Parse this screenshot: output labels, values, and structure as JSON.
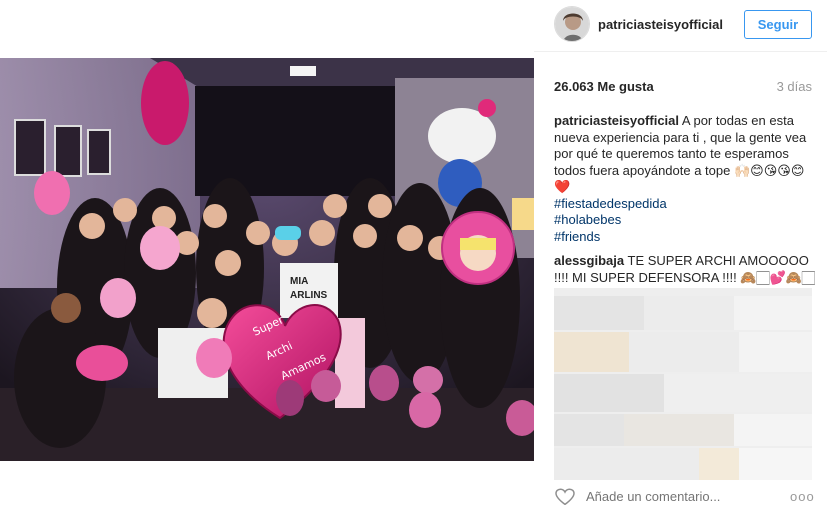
{
  "post": {
    "photo_alt": "Foto del post",
    "balloon_text_1": "Super",
    "balloon_text_2": "Archi",
    "balloon_text_3": "Amamos",
    "shirt_text_1": "MIA",
    "shirt_text_2": "ARLINS"
  },
  "header": {
    "username": "patriciasteisyofficial",
    "follow_label": "Seguir"
  },
  "stats": {
    "likes": "26.063 Me gusta",
    "time_ago": "3 días"
  },
  "caption": {
    "user": "patriciasteisyofficial",
    "text": "A por todas en esta nueva experiencia para ti , que la gente vea por qué te queremos tanto te esperamos todos fuera apoyándote a tope",
    "emoji_line": "🙌🏻😊😘😘😊❤️",
    "tags": [
      "#fiestadedespedida",
      "#holabebes",
      "#friends"
    ]
  },
  "comments": [
    {
      "user": "alessgibaja",
      "text": "TE SUPER ARCHI AMOOOOO !!!! MI SUPER DEFENSORA !!!! 🙈🏻💕🙈🏻"
    }
  ],
  "footer": {
    "comment_placeholder": "Añade un comentario...",
    "more_label": "ooo"
  },
  "colors": {
    "accent": "#3897f0",
    "hashtag": "#003569",
    "muted": "#999999"
  },
  "icons": {
    "heart": "heart-outline-icon",
    "more": "more-options-icon"
  }
}
